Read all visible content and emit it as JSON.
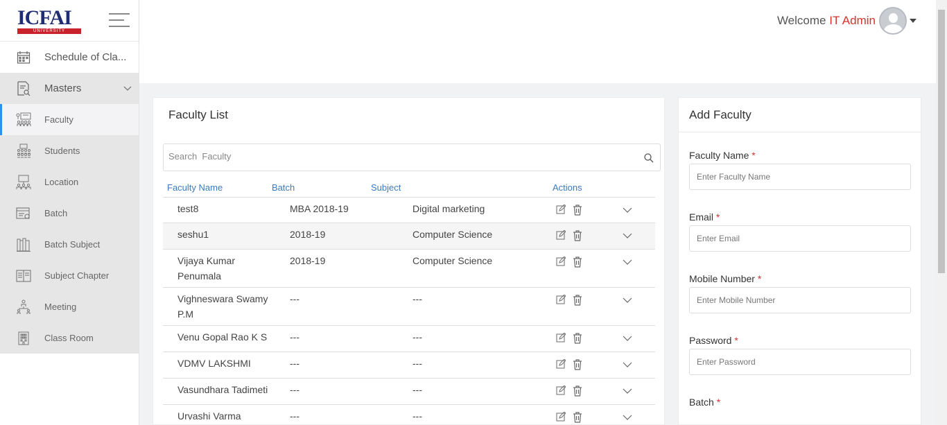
{
  "logo": {
    "name": "ICFAI",
    "tagline": "UNIVERSITY"
  },
  "header": {
    "welcome": "Welcome",
    "user": "IT Admin"
  },
  "sidebar": {
    "schedule": "Schedule of Cla...",
    "masters": "Masters",
    "items": [
      "Faculty",
      "Students",
      "Location",
      "Batch",
      "Batch Subject",
      "Subject Chapter",
      "Meeting",
      "Class Room"
    ]
  },
  "list": {
    "title": "Faculty List",
    "search_placeholder": "Search  Faculty",
    "columns": {
      "name": "Faculty Name",
      "batch": "Batch",
      "subject": "Subject",
      "actions": "Actions"
    },
    "rows": [
      {
        "name": "test8",
        "batch": "MBA 2018-19",
        "subject": "Digital marketing"
      },
      {
        "name": "seshu1",
        "batch": "2018-19",
        "subject": "Computer Science"
      },
      {
        "name": "Vijaya Kumar Penumala",
        "batch": "2018-19",
        "subject": "Computer Science"
      },
      {
        "name": "Vighneswara Swamy P.M",
        "batch": "---",
        "subject": "---"
      },
      {
        "name": "Venu Gopal Rao K S",
        "batch": "---",
        "subject": "---"
      },
      {
        "name": "VDMV LAKSHMI",
        "batch": "---",
        "subject": "---"
      },
      {
        "name": "Vasundhara Tadimeti",
        "batch": "---",
        "subject": "---"
      },
      {
        "name": "Urvashi Varma",
        "batch": "---",
        "subject": "---"
      }
    ]
  },
  "form": {
    "title": "Add Faculty",
    "required_mark": "*",
    "fields": [
      {
        "label": "Faculty Name",
        "placeholder": "Enter Faculty Name"
      },
      {
        "label": "Email",
        "placeholder": "Enter Email"
      },
      {
        "label": "Mobile Number",
        "placeholder": "Enter Mobile Number"
      },
      {
        "label": "Password",
        "placeholder": "Enter Password"
      }
    ],
    "batch_label": "Batch"
  }
}
